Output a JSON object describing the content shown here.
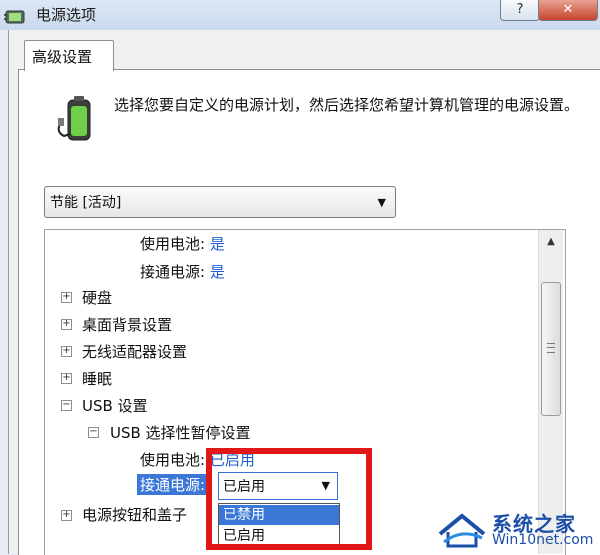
{
  "window": {
    "title": "电源选项",
    "help_label": "?",
    "close_label": "✕"
  },
  "tab": {
    "label": "高级设置"
  },
  "description": "选择您要自定义的电源计划，然后选择您希望计算机管理的电源设置。",
  "plan_select": {
    "value": "节能 [活动]"
  },
  "tree": {
    "battery_label": "使用电池:",
    "battery_value": "是",
    "plugged_label": "接通电源:",
    "plugged_value": "是",
    "items": [
      "硬盘",
      "桌面背景设置",
      "无线适配器设置",
      "睡眠"
    ],
    "usb_label": "USB 设置",
    "usb_suspend_label": "USB 选择性暂停设置",
    "usb_battery_label": "使用电池:",
    "usb_battery_value": "已启用",
    "usb_plugged_label": "接通电源:",
    "usb_plugged_value": "已启用",
    "power_button_label": "电源按钮和盖子"
  },
  "dropdown": {
    "options": [
      "已禁用",
      "已启用"
    ],
    "selected_index": 0
  },
  "watermark": {
    "name": "系统之家",
    "url": "Win10net.com"
  },
  "colors": {
    "link_blue": "#1f5fd1",
    "highlight_red": "#e01818",
    "selection_blue": "#3a77d6"
  }
}
